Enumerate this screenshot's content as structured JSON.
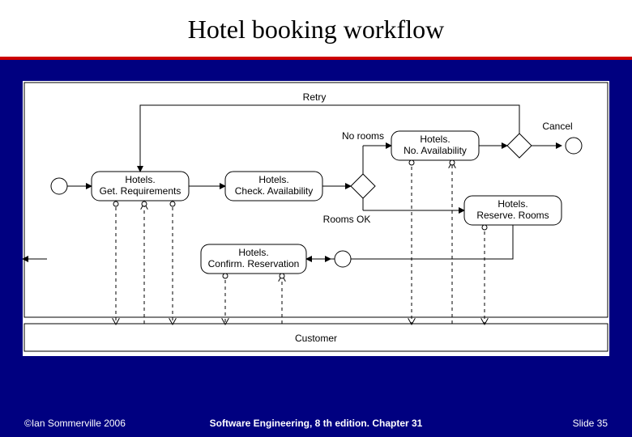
{
  "slide": {
    "title": "Hotel booking workflow",
    "footer_left": "©Ian Sommerville 2006",
    "footer_mid": "Software Engineering, 8 th edition. Chapter 31",
    "footer_right": "Slide 35"
  },
  "diagram": {
    "swimlane_label": "Customer",
    "edge_labels": {
      "retry": "Retry",
      "no_rooms": "No rooms",
      "rooms_ok": "Rooms OK",
      "cancel": "Cancel"
    },
    "nodes": {
      "get_requirements": {
        "l1": "Hotels.",
        "l2": "Get. Requirements"
      },
      "check_availability": {
        "l1": "Hotels.",
        "l2": "Check. Availability"
      },
      "no_availability": {
        "l1": "Hotels.",
        "l2": "No. Availability"
      },
      "reserve_rooms": {
        "l1": "Hotels.",
        "l2": "Reserve. Rooms"
      },
      "confirm_reservation": {
        "l1": "Hotels.",
        "l2": "Confirm. Reservation"
      }
    }
  }
}
